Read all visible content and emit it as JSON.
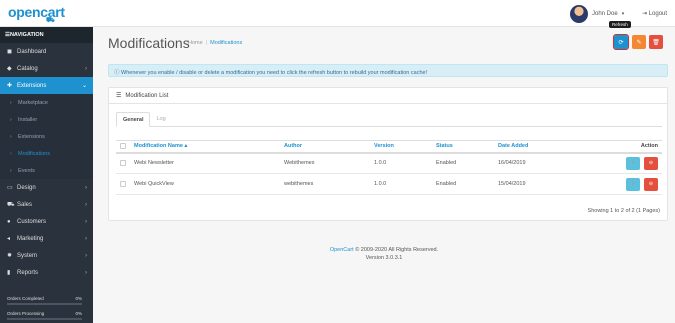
{
  "header": {
    "logo_text": "opencart",
    "user_name": "John Doe",
    "logout_label": "Logout"
  },
  "sidebar": {
    "title": "NAVIGATION",
    "items": [
      {
        "label": "Dashboard",
        "icon": "dashboard-icon"
      },
      {
        "label": "Catalog",
        "icon": "tag-icon"
      },
      {
        "label": "Extensions",
        "icon": "puzzle-icon"
      },
      {
        "label": "Design",
        "icon": "monitor-icon"
      },
      {
        "label": "Sales",
        "icon": "cart-icon"
      },
      {
        "label": "Customers",
        "icon": "user-icon"
      },
      {
        "label": "Marketing",
        "icon": "share-icon"
      },
      {
        "label": "System",
        "icon": "cog-icon"
      },
      {
        "label": "Reports",
        "icon": "bar-chart-icon"
      }
    ],
    "sub_items": [
      "Marketplace",
      "Installer",
      "Extensions",
      "Modifications",
      "Events"
    ],
    "stats": [
      {
        "label": "Orders Completed",
        "value": "0%",
        "fill": 0
      },
      {
        "label": "Orders Processing",
        "value": "0%",
        "fill": 0
      }
    ]
  },
  "page": {
    "title": "Modifications",
    "breadcrumb": [
      "Home",
      "Modifications"
    ],
    "tooltip": "Refresh",
    "alert": "Whenever you enable / disable or delete a modification you need to click the refresh button to rebuild your modification cache!",
    "panel_title": "Modification List",
    "tabs": [
      "General",
      "Log"
    ],
    "table": {
      "headers": [
        "Modification Name",
        "Author",
        "Version",
        "Status",
        "Date Added",
        "Action"
      ],
      "rows": [
        [
          "Webi Newsletter",
          "Webithemes",
          "1.0.0",
          "Enabled",
          "16/04/2019"
        ],
        [
          "Webi QuickView",
          "webithemes",
          "1.0.0",
          "Enabled",
          "15/04/2019"
        ]
      ]
    },
    "pager_text": "Showing 1 to 2 of 2 (1 Pages)"
  },
  "footer": {
    "brand": "OpenCart",
    "copyright": " © 2009-2020 All Rights Reserved.",
    "version": "Version 3.0.3.1"
  },
  "colors": {
    "primary": "#1e91cf",
    "warning": "#f38733",
    "danger": "#e3503e",
    "sidebar_bg": "#2a333d"
  }
}
